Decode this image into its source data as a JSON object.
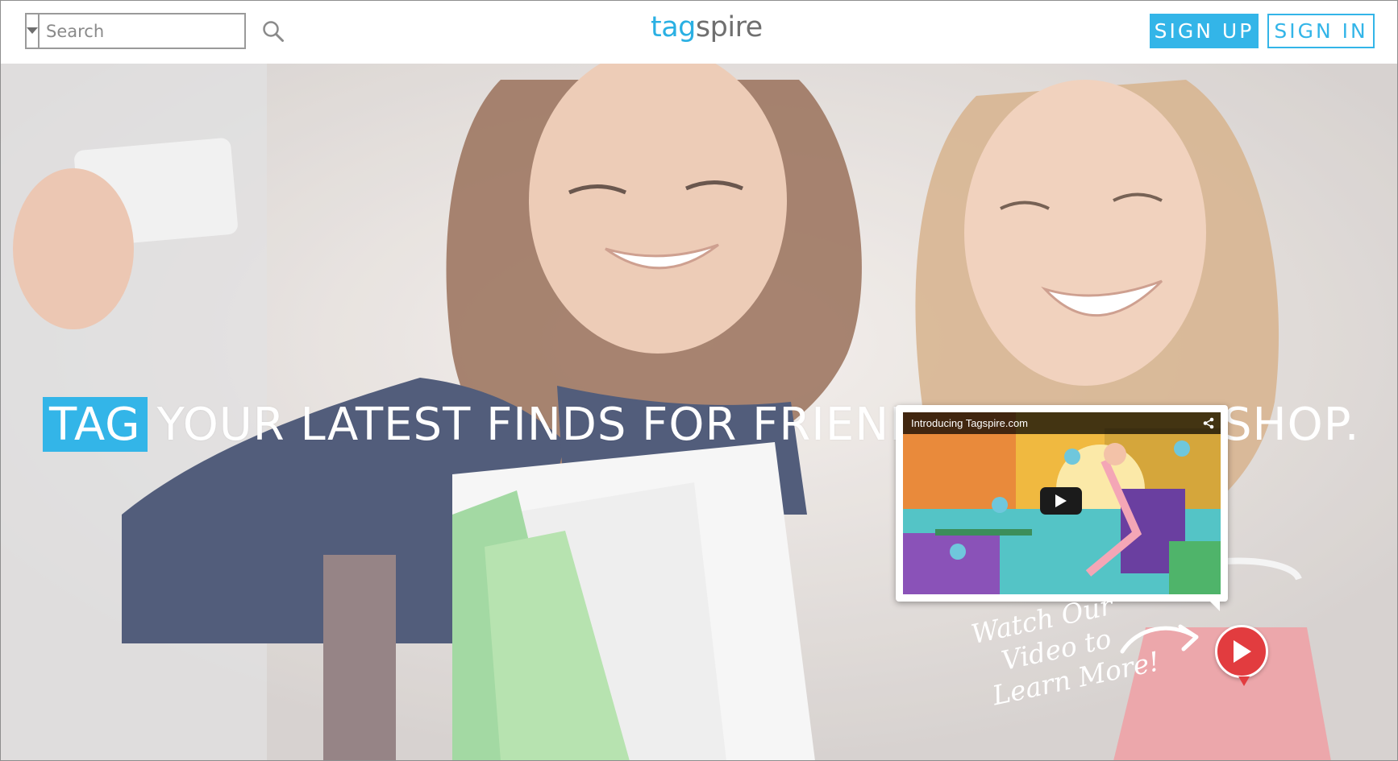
{
  "header": {
    "search": {
      "placeholder": "Search",
      "value": ""
    },
    "logo": {
      "part1": "tag",
      "part2": "spire"
    },
    "sign_up_label": "SIGN UP",
    "sign_in_label": "SIGN IN"
  },
  "hero": {
    "headline_tag": "TAG",
    "headline_rest": "YOUR LATEST FINDS FOR FRIENDS",
    "headline_end": "SHOP.",
    "video": {
      "title": "Introducing Tagspire.com"
    },
    "watch_note": {
      "line1": "Watch Our",
      "line2": "Video to",
      "line3": "Learn More!"
    }
  },
  "colors": {
    "accent": "#33b5e8",
    "logo_tag": "#2ab0e3",
    "logo_spire": "#6f6f6f",
    "play_red": "#e23c3f"
  },
  "icons": [
    "chevron-down-icon",
    "search-icon",
    "share-icon",
    "play-icon",
    "arrow-icon"
  ]
}
